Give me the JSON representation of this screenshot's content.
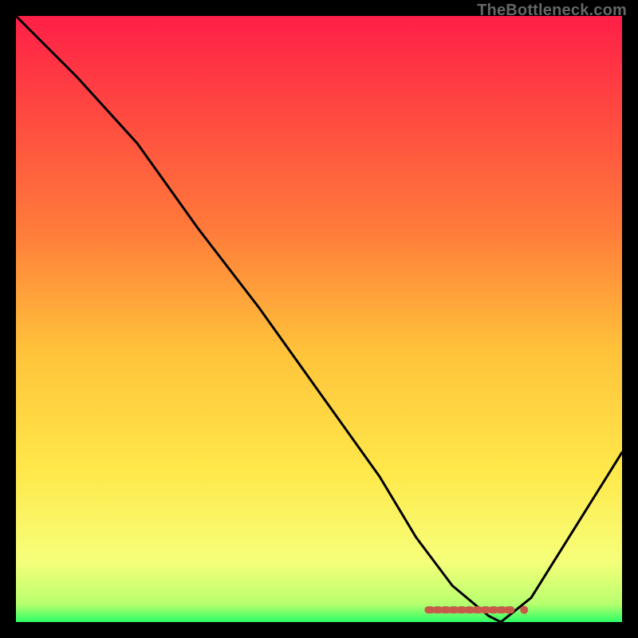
{
  "watermark": "TheBottleneck.com",
  "chart_data": {
    "type": "line",
    "title": "",
    "xlabel": "",
    "ylabel": "",
    "xlim": [
      0,
      100
    ],
    "ylim": [
      0,
      100
    ],
    "gradient_stops": [
      {
        "offset": 0,
        "color": "#ff1f47"
      },
      {
        "offset": 35,
        "color": "#ff7a3a"
      },
      {
        "offset": 55,
        "color": "#ffc23a"
      },
      {
        "offset": 75,
        "color": "#ffe84a"
      },
      {
        "offset": 90,
        "color": "#f6ff7a"
      },
      {
        "offset": 97,
        "color": "#b8ff6e"
      },
      {
        "offset": 100,
        "color": "#2dff66"
      }
    ],
    "series": [
      {
        "name": "bottleneck-curve",
        "x": [
          0,
          10,
          20,
          25,
          30,
          40,
          50,
          60,
          66,
          72,
          78,
          80,
          85,
          90,
          95,
          100
        ],
        "y": [
          100,
          90,
          79,
          72,
          65,
          52,
          38,
          24,
          14,
          6,
          1,
          0,
          4,
          12,
          20,
          28
        ]
      }
    ],
    "marker": {
      "name": "optimal-range",
      "x_start": 68,
      "x_end": 82,
      "y": 2,
      "color": "#c85a4a"
    }
  }
}
